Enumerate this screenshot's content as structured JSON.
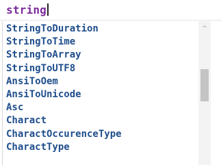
{
  "editor": {
    "typed_text": "string"
  },
  "autocomplete": {
    "items": [
      "StringToDuration",
      "StringToTime",
      "StringToArray",
      "StringToUTF8",
      "AnsiToOem",
      "AnsiToUnicode",
      "Asc",
      "Charact",
      "CharactOccurenceType",
      "CharactType"
    ],
    "scroll_up_glyph": "^"
  },
  "colors": {
    "typed_text": "#7a2a9c",
    "item_text": "#1f4e8c",
    "scroll_track": "#f3f3f3",
    "scroll_thumb": "#c4c4c4"
  },
  "icons": {
    "scroll_up": "chevron-up-icon",
    "caret": "text-caret"
  }
}
